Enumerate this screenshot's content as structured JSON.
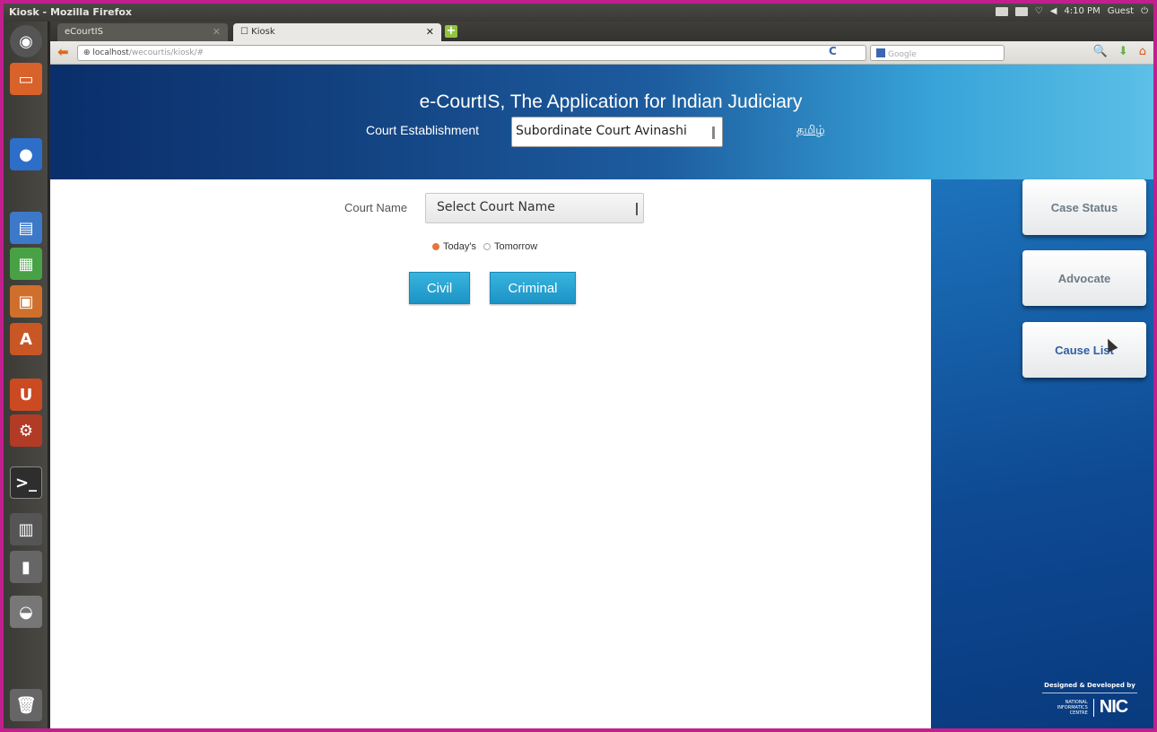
{
  "system": {
    "window_title": "Kiosk - Mozilla Firefox",
    "clock": "4:10 PM",
    "user": "Guest"
  },
  "browser": {
    "tabs": [
      {
        "label": "eCourtIS",
        "active": false
      },
      {
        "label": "Kiosk",
        "active": true
      }
    ],
    "url_host": "localhost",
    "url_path": "/wecourtis/kiosk/#",
    "search_placeholder": "Google"
  },
  "header": {
    "title": "e-CourtIS, The Application for Indian Judiciary",
    "establishment_label": "Court Establishment",
    "establishment_value": "Subordinate Court Avinashi",
    "language_link": "தமிழ்"
  },
  "form": {
    "court_name_label": "Court Name",
    "court_name_value": "Select Court Name",
    "radio_today": "Today's",
    "radio_tomorrow": "Tomorrow",
    "selected_day": "today",
    "civil_button": "Civil",
    "criminal_button": "Criminal"
  },
  "sidebar": {
    "case_status": "Case Status",
    "advocate": "Advocate",
    "cause_list": "Cause List"
  },
  "footer": {
    "designed_by": "Designed & Developed by",
    "nic_full": "NATIONAL INFORMATICS CENTRE",
    "nic_logo": "NIC"
  },
  "colors": {
    "accent_blue": "#1c93c5",
    "frame_border": "#c21f8e",
    "radio_selected": "#e9743a"
  }
}
